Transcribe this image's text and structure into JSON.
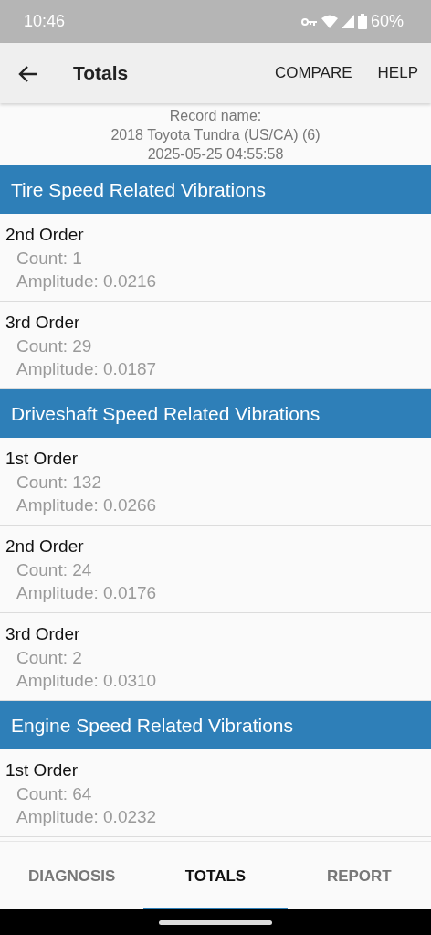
{
  "status_bar": {
    "time": "10:46",
    "battery": "60%"
  },
  "toolbar": {
    "title": "Totals",
    "actions": [
      "COMPARE",
      "HELP"
    ]
  },
  "record": {
    "label": "Record name:",
    "name": "2018 Toyota Tundra (US/CA) (6)",
    "date": "2025-05-25 04:55:58"
  },
  "sections": [
    {
      "title": "Tire Speed Related Vibrations",
      "items": [
        {
          "order": "2nd Order",
          "count": "Count: 1",
          "amplitude": "Amplitude: 0.0216"
        },
        {
          "order": "3rd Order",
          "count": "Count: 29",
          "amplitude": "Amplitude: 0.0187"
        }
      ]
    },
    {
      "title": "Driveshaft Speed Related Vibrations",
      "items": [
        {
          "order": "1st Order",
          "count": "Count: 132",
          "amplitude": "Amplitude: 0.0266"
        },
        {
          "order": "2nd Order",
          "count": "Count: 24",
          "amplitude": "Amplitude: 0.0176"
        },
        {
          "order": "3rd Order",
          "count": "Count: 2",
          "amplitude": "Amplitude: 0.0310"
        }
      ]
    },
    {
      "title": "Engine Speed Related Vibrations",
      "items": [
        {
          "order": "1st Order",
          "count": "Count: 64",
          "amplitude": "Amplitude: 0.0232"
        }
      ]
    }
  ],
  "tabs": [
    {
      "label": "DIAGNOSIS",
      "selected": false
    },
    {
      "label": "TOTALS",
      "selected": true
    },
    {
      "label": "REPORT",
      "selected": false
    }
  ]
}
